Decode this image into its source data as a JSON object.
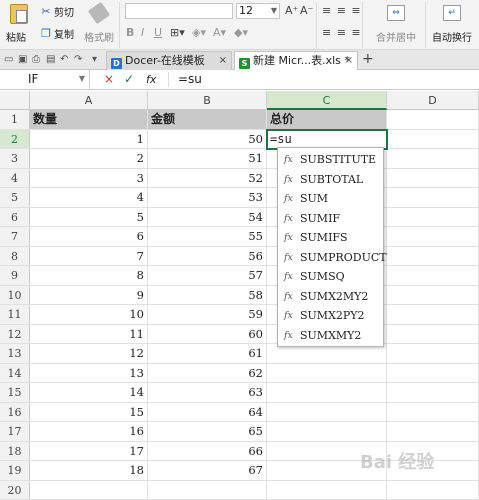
{
  "ribbon": {
    "paste_label": "粘贴",
    "cut_label": "剪切",
    "copy_label": "复制",
    "format_painter_label": "格式刷",
    "font_size": "12",
    "bold": "B",
    "italic": "I",
    "underline": "U",
    "grow_font": "A⁺",
    "shrink_font": "A⁻",
    "merge_center_label": "合并居中",
    "wrap_text_label": "自动换行"
  },
  "tabs": [
    {
      "label": "Docer-在线模板",
      "icon": "docer-icon",
      "color": "#2f6fc4",
      "close": "×"
    },
    {
      "label": "新建 Micr...表.xls *",
      "icon": "spreadsheet-icon",
      "color": "#2b8a3e",
      "close": "×"
    }
  ],
  "new_tab": "+",
  "formula_bar": {
    "name_box": "IF",
    "cancel": "×",
    "enter": "✓",
    "fx": "fx",
    "content": "=su"
  },
  "columns": [
    "A",
    "B",
    "C",
    "D"
  ],
  "rows": [
    {
      "num": "1",
      "a": "数量",
      "b": "金额",
      "c": "总价"
    },
    {
      "num": "2",
      "a": "1",
      "b": "50",
      "c": "=su"
    },
    {
      "num": "3",
      "a": "2",
      "b": "51",
      "c": ""
    },
    {
      "num": "4",
      "a": "3",
      "b": "52",
      "c": ""
    },
    {
      "num": "5",
      "a": "4",
      "b": "53",
      "c": ""
    },
    {
      "num": "6",
      "a": "5",
      "b": "54",
      "c": ""
    },
    {
      "num": "7",
      "a": "6",
      "b": "55",
      "c": ""
    },
    {
      "num": "8",
      "a": "7",
      "b": "56",
      "c": ""
    },
    {
      "num": "9",
      "a": "8",
      "b": "57",
      "c": ""
    },
    {
      "num": "10",
      "a": "9",
      "b": "58",
      "c": ""
    },
    {
      "num": "11",
      "a": "10",
      "b": "59",
      "c": ""
    },
    {
      "num": "12",
      "a": "11",
      "b": "60",
      "c": ""
    },
    {
      "num": "13",
      "a": "12",
      "b": "61",
      "c": ""
    },
    {
      "num": "14",
      "a": "13",
      "b": "62",
      "c": ""
    },
    {
      "num": "15",
      "a": "14",
      "b": "63",
      "c": ""
    },
    {
      "num": "16",
      "a": "15",
      "b": "64",
      "c": ""
    },
    {
      "num": "17",
      "a": "16",
      "b": "65",
      "c": ""
    },
    {
      "num": "18",
      "a": "17",
      "b": "66",
      "c": ""
    },
    {
      "num": "19",
      "a": "18",
      "b": "67",
      "c": ""
    },
    {
      "num": "20",
      "a": "",
      "b": "",
      "c": ""
    },
    {
      "num": "21",
      "a": "",
      "b": "",
      "c": ""
    }
  ],
  "autocomplete": {
    "icon_label": "fx",
    "items": [
      "SUBSTITUTE",
      "SUBTOTAL",
      "SUM",
      "SUMIF",
      "SUMIFS",
      "SUMPRODUCT",
      "SUMSQ",
      "SUMX2MY2",
      "SUMX2PY2",
      "SUMXMY2"
    ]
  },
  "watermark": "Bai 经验",
  "colors": {
    "accent_green": "#217346",
    "header_fill": "#c9c9c9"
  }
}
